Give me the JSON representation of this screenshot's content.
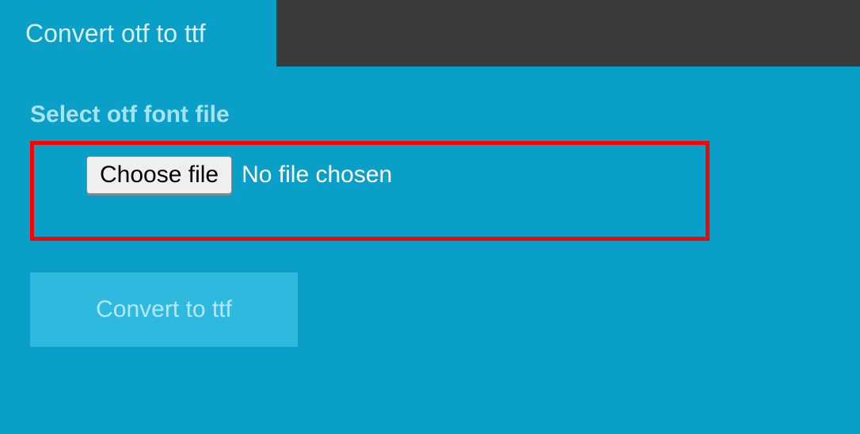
{
  "tab": {
    "label": "Convert otf to ttf"
  },
  "section": {
    "label": "Select otf font file"
  },
  "file_input": {
    "button_label": "Choose file",
    "status_text": "No file chosen"
  },
  "convert_button": {
    "label": "Convert to ttf"
  }
}
